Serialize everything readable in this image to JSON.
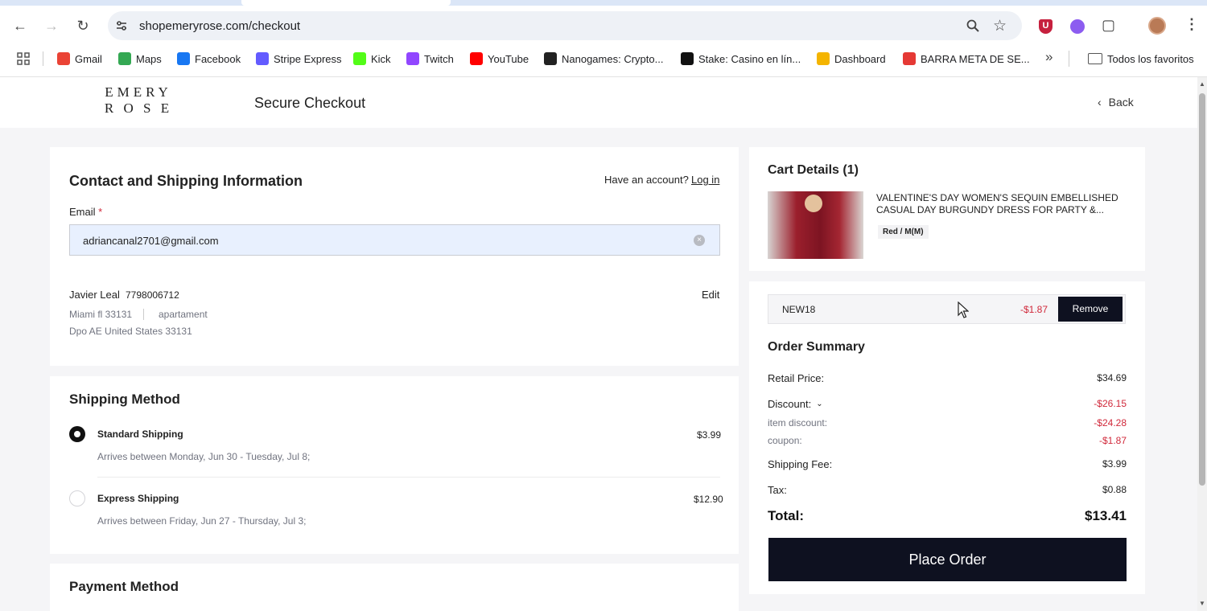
{
  "browser": {
    "url": "shopemeryrose.com/checkout",
    "bookmarks": [
      {
        "label": "Gmail",
        "icon": "gmail-icon",
        "color": "#ea4335"
      },
      {
        "label": "Maps",
        "icon": "maps-icon",
        "color": "#34a853"
      },
      {
        "label": "Facebook",
        "icon": "facebook-icon",
        "color": "#1877f2"
      },
      {
        "label": "Stripe Express",
        "icon": "stripe-icon",
        "color": "#635bff"
      },
      {
        "label": "Kick",
        "icon": "kick-icon",
        "color": "#53fc18"
      },
      {
        "label": "Twitch",
        "icon": "twitch-icon",
        "color": "#9146ff"
      },
      {
        "label": "YouTube",
        "icon": "youtube-icon",
        "color": "#ff0000"
      },
      {
        "label": "Nanogames: Crypto...",
        "icon": "nanogames-icon",
        "color": "#222222"
      },
      {
        "label": "Stake: Casino en lín...",
        "icon": "stake-icon",
        "color": "#111111"
      },
      {
        "label": "Dashboard",
        "icon": "dashboard-icon",
        "color": "#f4b400"
      },
      {
        "label": "BARRA META DE SE...",
        "icon": "barra-icon",
        "color": "#e53935"
      }
    ],
    "all_bookmarks": "Todos los favoritos"
  },
  "header": {
    "logo_line1": "EMERY",
    "logo_line2": "R O S E",
    "title": "Secure Checkout",
    "back": "Back"
  },
  "contact": {
    "title": "Contact and Shipping Information",
    "have_account": "Have an account?",
    "login": "Log in",
    "email_label": "Email",
    "required_mark": "*",
    "email_value": "adriancanal2701@gmail.com",
    "name": "Javier Leal",
    "phone": "7798006712",
    "city": "Miami fl 33131",
    "apt": "apartament",
    "region": "Dpo AE United States 33131",
    "edit": "Edit"
  },
  "shipping": {
    "title": "Shipping Method",
    "options": [
      {
        "name": "Standard Shipping",
        "eta": "Arrives between Monday, Jun 30 - Tuesday, Jul 8;",
        "price": "$3.99",
        "selected": true
      },
      {
        "name": "Express Shipping",
        "eta": "Arrives between Friday, Jun 27 - Thursday, Jul 3;",
        "price": "$12.90",
        "selected": false
      }
    ]
  },
  "payment": {
    "title": "Payment Method"
  },
  "cart": {
    "title": "Cart Details (1)",
    "item_name": "VALENTINE'S DAY WOMEN'S SEQUIN EMBELLISHED CASUAL DAY BURGUNDY DRESS FOR PARTY &...",
    "item_variant": "Red / M(M)"
  },
  "coupon": {
    "code": "NEW18",
    "amount": "-$1.87",
    "remove": "Remove"
  },
  "summary": {
    "title": "Order Summary",
    "retail_label": "Retail Price:",
    "retail": "$34.69",
    "discount_label": "Discount:",
    "discount": "-$26.15",
    "item_discount_label": "item discount:",
    "item_discount": "-$24.28",
    "coupon_label": "coupon:",
    "coupon": "-$1.87",
    "shipping_label": "Shipping Fee:",
    "shipping": "$3.99",
    "tax_label": "Tax:",
    "tax": "$0.88",
    "total_label": "Total:",
    "total": "$13.41",
    "place_order": "Place Order"
  }
}
